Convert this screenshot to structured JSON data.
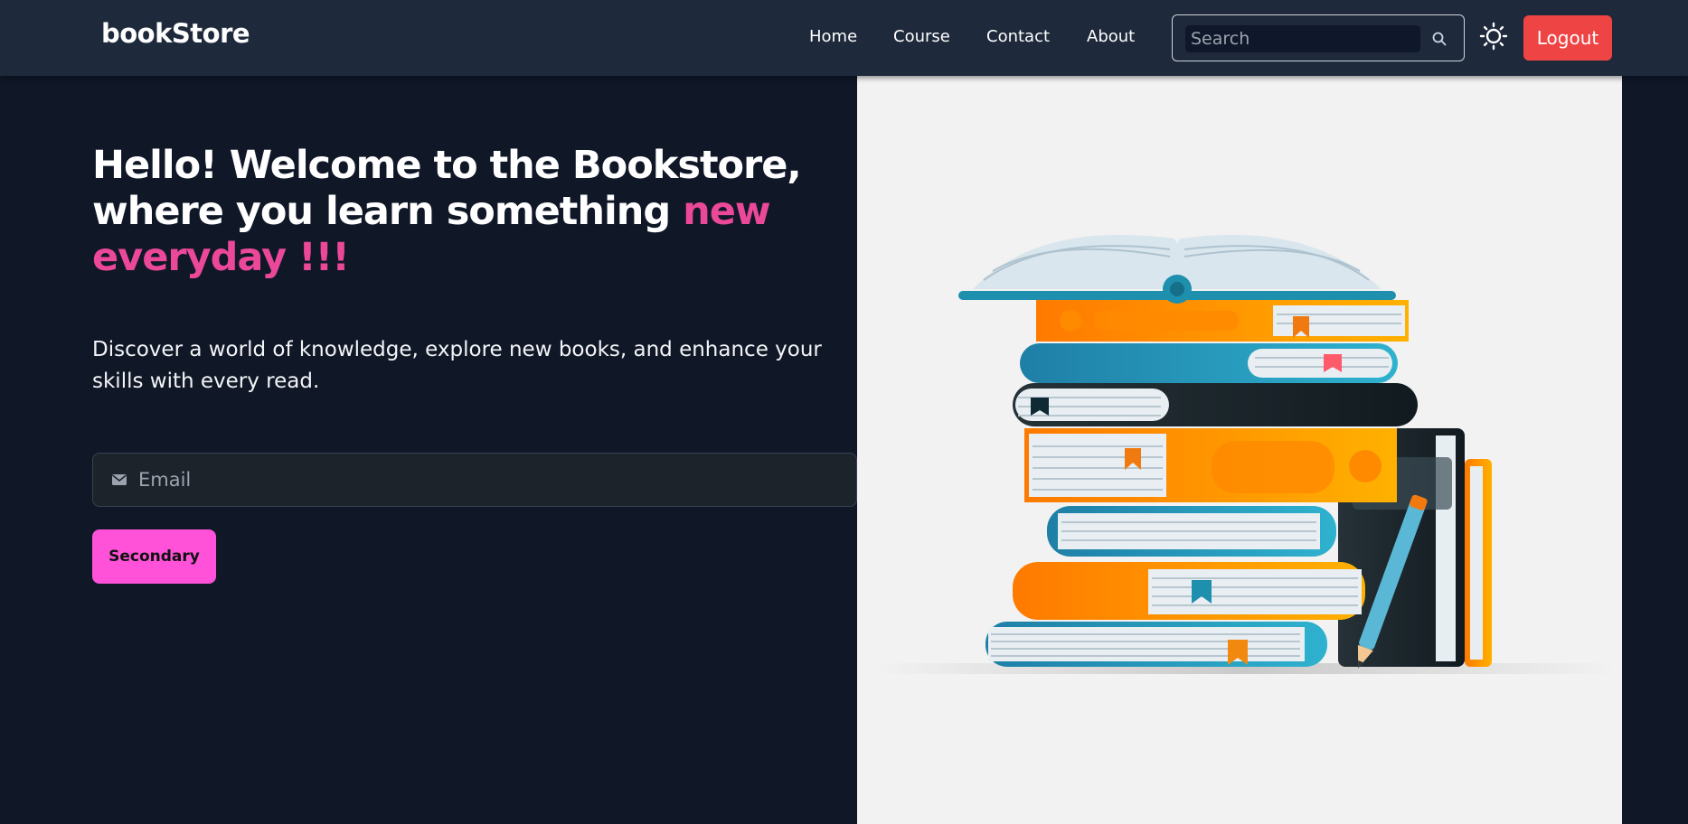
{
  "brand": "bookStore",
  "nav": {
    "links": [
      "Home",
      "Course",
      "Contact",
      "About"
    ],
    "search_placeholder": "Search",
    "theme_icon": "sun-icon",
    "logout_label": "Logout"
  },
  "hero": {
    "title_main": "Hello! Welcome to the Bookstore, where you learn something ",
    "title_accent": "new everyday !!!",
    "subtitle": "Discover a world of knowledge, explore new books, and enhance your skills with every read.",
    "email_placeholder": "Email",
    "email_icon": "mail-icon",
    "button_label": "Secondary",
    "illustration": "stack-of-books-illustration"
  },
  "colors": {
    "background": "#101828",
    "navbar": "#1e293b",
    "accent_text": "#ec4899",
    "logout": "#ef4444",
    "secondary_button": "#ff52d9",
    "image_panel": "#f2f2f2"
  }
}
